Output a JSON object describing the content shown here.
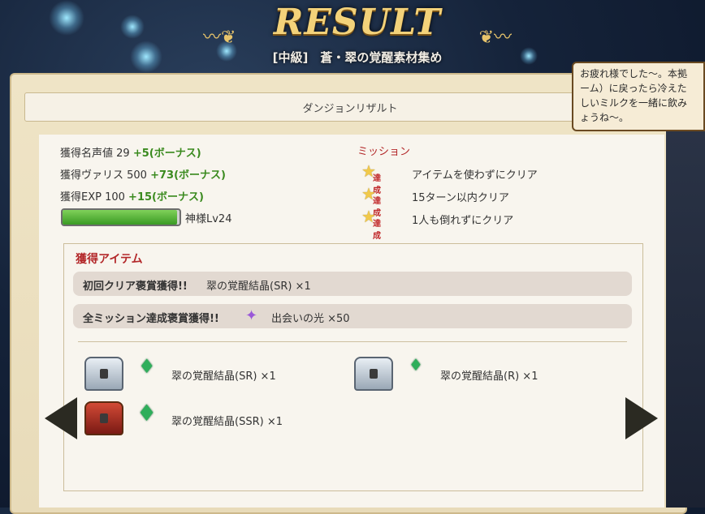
{
  "title": "RESULT",
  "subtitle": "[中級]　蒼・翠の覚醒素材集め",
  "header": "ダンジョンリザルト",
  "stats": {
    "fame_label": "獲得名声値 29",
    "fame_bonus": "+5(ボーナス)",
    "vallis_label": "獲得ヴァリス 500",
    "vallis_bonus": "+73(ボーナス)",
    "exp_label": "獲得EXP 100",
    "exp_bonus": "+15(ボーナス)",
    "level": "神様Lv24",
    "exp_progress": 0.98
  },
  "missions": {
    "heading": "ミッション",
    "achieved_label": "達成",
    "items": [
      "アイテムを使わずにクリア",
      "15ターン以内クリア",
      "1人も倒れずにクリア"
    ]
  },
  "items": {
    "heading": "獲得アイテム",
    "first_clear_label": "初回クリア褒賞獲得!!",
    "first_clear_item": "翠の覚醒結晶(SR) ×1",
    "all_mission_label": "全ミッション達成褒賞獲得!!",
    "all_mission_item": "出会いの光 ×50",
    "drops": [
      "翠の覚醒結晶(SR) ×1",
      "翠の覚醒結晶(R) ×1",
      "翠の覚醒結晶(SSR) ×1"
    ]
  },
  "bubble": {
    "lines": [
      "お疲れ様でした〜。本拠",
      "ーム）に戻ったら冷えた",
      "しいミルクを一緒に飲み",
      "ょうね〜。"
    ]
  },
  "colors": {
    "accent_red": "#b3282a",
    "bonus_green": "#3a8a1e",
    "gold": "#f3d27a"
  }
}
